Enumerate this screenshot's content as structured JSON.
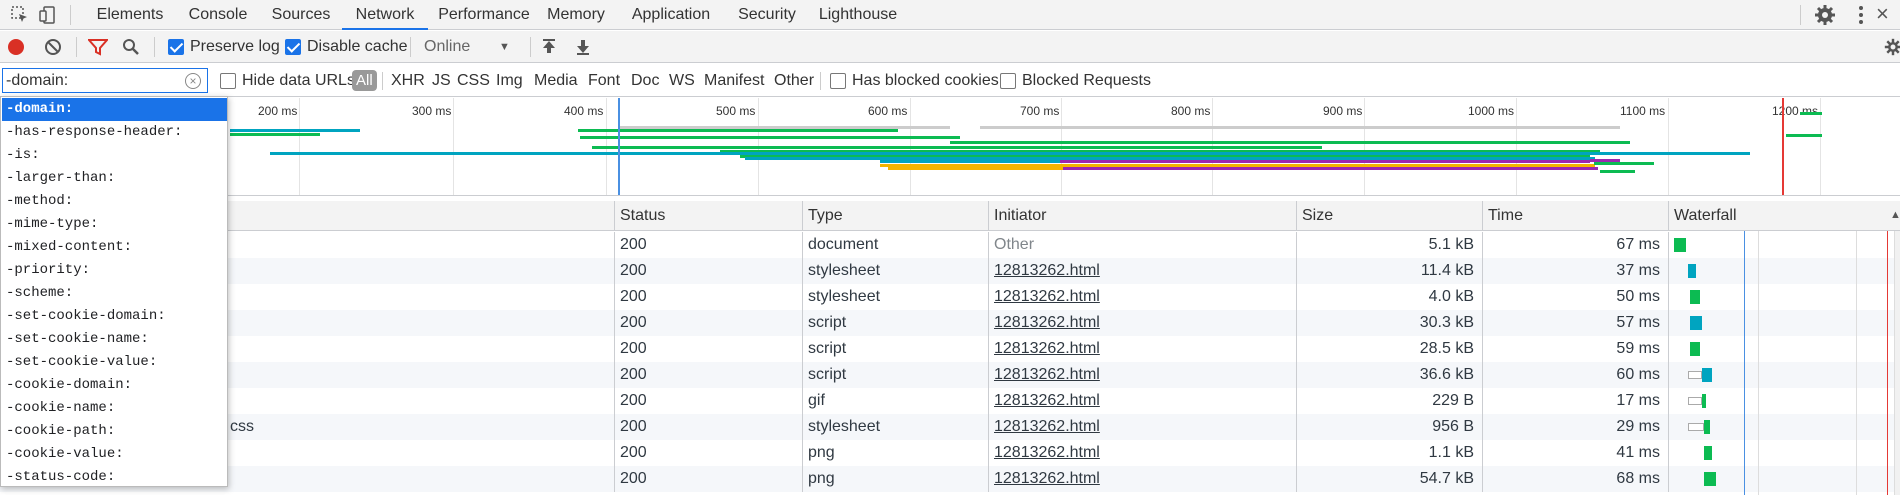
{
  "tabs": [
    "Elements",
    "Console",
    "Sources",
    "Network",
    "Performance",
    "Memory",
    "Application",
    "Security",
    "Lighthouse"
  ],
  "active_tab": "Network",
  "toolbar": {
    "preserve_log": "Preserve log",
    "disable_cache": "Disable cache",
    "throttling": "Online",
    "preserve_log_checked": true,
    "disable_cache_checked": true
  },
  "filter": {
    "value": "-domain:",
    "hide_data_urls": "Hide data URLs",
    "types": [
      "All",
      "XHR",
      "JS",
      "CSS",
      "Img",
      "Media",
      "Font",
      "Doc",
      "WS",
      "Manifest",
      "Other"
    ],
    "has_blocked_cookies": "Has blocked cookies",
    "blocked_requests": "Blocked Requests"
  },
  "overview": {
    "ticks": [
      "200 ms",
      "300 ms",
      "400 ms",
      "500 ms",
      "600 ms",
      "700 ms",
      "800 ms",
      "900 ms",
      "1000 ms",
      "1100 ms",
      "1200 ms"
    ]
  },
  "suggestions": [
    "-domain:",
    "-has-response-header:",
    "-is:",
    "-larger-than:",
    "-method:",
    "-mime-type:",
    "-mixed-content:",
    "-priority:",
    "-scheme:",
    "-set-cookie-domain:",
    "-set-cookie-name:",
    "-set-cookie-value:",
    "-cookie-domain:",
    "-cookie-name:",
    "-cookie-path:",
    "-cookie-value:",
    "-status-code:"
  ],
  "table": {
    "headers": {
      "status": "Status",
      "type": "Type",
      "initiator": "Initiator",
      "size": "Size",
      "time": "Time",
      "waterfall": "Waterfall"
    },
    "rows": [
      {
        "name": "",
        "status": "200",
        "type": "document",
        "initiator": "Other",
        "size": "5.1 kB",
        "time": "67 ms"
      },
      {
        "name": "",
        "status": "200",
        "type": "stylesheet",
        "initiator": "12813262.html",
        "size": "11.4 kB",
        "time": "37 ms"
      },
      {
        "name": "",
        "status": "200",
        "type": "stylesheet",
        "initiator": "12813262.html",
        "size": "4.0 kB",
        "time": "50 ms"
      },
      {
        "name": "",
        "status": "200",
        "type": "script",
        "initiator": "12813262.html",
        "size": "30.3 kB",
        "time": "57 ms"
      },
      {
        "name": "",
        "status": "200",
        "type": "script",
        "initiator": "12813262.html",
        "size": "28.5 kB",
        "time": "59 ms"
      },
      {
        "name": "",
        "status": "200",
        "type": "script",
        "initiator": "12813262.html",
        "size": "36.6 kB",
        "time": "60 ms"
      },
      {
        "name": "",
        "status": "200",
        "type": "gif",
        "initiator": "12813262.html",
        "size": "229 B",
        "time": "17 ms"
      },
      {
        "name": "css",
        "status": "200",
        "type": "stylesheet",
        "initiator": "12813262.html",
        "size": "956 B",
        "time": "29 ms"
      },
      {
        "name": "",
        "status": "200",
        "type": "png",
        "initiator": "12813262.html",
        "size": "1.1 kB",
        "time": "41 ms"
      },
      {
        "name": "",
        "status": "200",
        "type": "png",
        "initiator": "12813262.html",
        "size": "54.7 kB",
        "time": "68 ms"
      }
    ]
  },
  "colors": {
    "accent": "#1a73e8",
    "record": "#d93025",
    "green": "#0cbb52",
    "teal": "#00a4c0",
    "orange": "#f4b400",
    "purple": "#9c27b0",
    "red_line": "#e53935",
    "blue_line": "#4a90e2"
  }
}
